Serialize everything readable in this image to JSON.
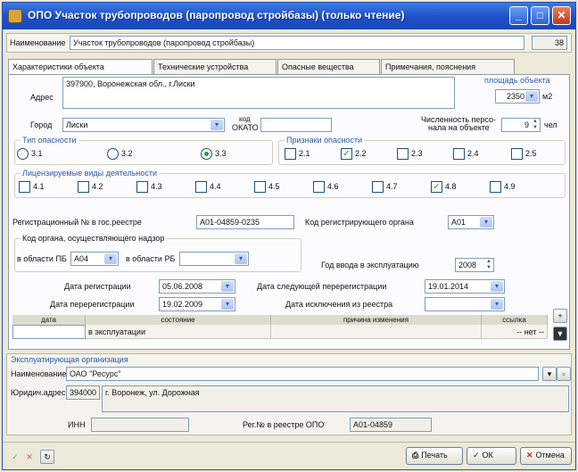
{
  "window": {
    "title": "ОПО Участок трубопроводов (паропровод стройбазы) (только чтение)",
    "min_glyph": "_",
    "max_glyph": "□",
    "close_glyph": "✕"
  },
  "header": {
    "name_label": "Наименование",
    "name_value": "Участок трубопроводов (паропровод стройбазы)",
    "id_value": "38"
  },
  "tabs": [
    {
      "label": "Характеристики объекта",
      "active": true
    },
    {
      "label": "Технические устройства",
      "active": false
    },
    {
      "label": "Опасные вещества",
      "active": false
    },
    {
      "label": "Примечания, пояснения",
      "active": false
    }
  ],
  "address": {
    "label": "Адрес",
    "value": "397900, Воронежская обл., г.Лиски",
    "area_label": "площадь объекта",
    "area_value": "2350",
    "area_unit": "м2"
  },
  "city": {
    "label": "Город",
    "value": "Лиски",
    "okato_label_1": "код",
    "okato_label_2": "ОКАТО",
    "okato_value": "",
    "staff_label_1": "Численность персо-",
    "staff_label_2": "нала на объекте",
    "staff_value": "9",
    "staff_unit": "чел"
  },
  "hazard_type": {
    "title": "Тип опасности",
    "options": [
      {
        "label": "3.1",
        "selected": false
      },
      {
        "label": "3.2",
        "selected": false
      },
      {
        "label": "3.3",
        "selected": true
      }
    ]
  },
  "hazard_signs": {
    "title": "Признаки опасности",
    "options": [
      {
        "label": "2.1",
        "checked": false,
        "mark": ""
      },
      {
        "label": "2.2",
        "checked": true,
        "mark": "✓"
      },
      {
        "label": "2.3",
        "checked": false,
        "mark": ""
      },
      {
        "label": "2.4",
        "checked": false,
        "mark": ""
      },
      {
        "label": "2.5",
        "checked": false,
        "mark": ""
      }
    ]
  },
  "licensed": {
    "title": "Лицензируемые виды деятельности",
    "options": [
      {
        "label": "4.1",
        "checked": false,
        "mark": ""
      },
      {
        "label": "4.2",
        "checked": false,
        "mark": ""
      },
      {
        "label": "4.3",
        "checked": false,
        "mark": ""
      },
      {
        "label": "4.4",
        "checked": false,
        "mark": ""
      },
      {
        "label": "4.5",
        "checked": false,
        "mark": ""
      },
      {
        "label": "4.6",
        "checked": false,
        "mark": ""
      },
      {
        "label": "4.7",
        "checked": false,
        "mark": ""
      },
      {
        "label": "4.8",
        "checked": true,
        "mark": "✓"
      },
      {
        "label": "4.9",
        "checked": false,
        "mark": ""
      }
    ]
  },
  "registry": {
    "reg_label": "Регистрационный № в гос.реестре",
    "reg_value": "А01-04859-0235",
    "org_code_label": "Код регистрирующего органа",
    "org_code_value": "А01",
    "supervision_title": "Код органа, осуществляющего надзор",
    "pb_label": "в области ПБ",
    "pb_value": "А04",
    "rb_label": "в области РБ",
    "rb_value": "",
    "year_label": "Год ввода в эксплуатацию",
    "year_value": "2008",
    "reg_date_label": "Дата регистрации",
    "reg_date_value": "05.06.2008",
    "next_rereg_label": "Дата следующей перерегистрации",
    "next_rereg_value": "19.01.2014",
    "rereg_date_label": "Дата перерегистрации",
    "rereg_date_value": "19.02.2009",
    "excl_label": "Дата исключения из реестра",
    "excl_value": ""
  },
  "status_table": {
    "columns": [
      "дата",
      "состояние",
      "причина изменения",
      "ссылка"
    ],
    "rows": [
      {
        "date": "",
        "state": "в эксплуатации",
        "reason": "",
        "link": "-- нет --"
      }
    ]
  },
  "operator": {
    "title": "Эксплуатирующая организация",
    "name_label": "Наименование",
    "name_value": "ОАО \"Ресурс\"",
    "legal_address_label": "Юридич.адрес",
    "postcode_value": "394000",
    "street_value": "г. Воронеж, ул. Дорожная",
    "inn_label": "ИНН",
    "inn_value": "",
    "reestr_label": "Рег.№ в реестре ОПО",
    "reestr_value": "А01-04859"
  },
  "footer": {
    "print_label": "Печать",
    "ok_label": "ОК",
    "cancel_label": "Отмена"
  }
}
